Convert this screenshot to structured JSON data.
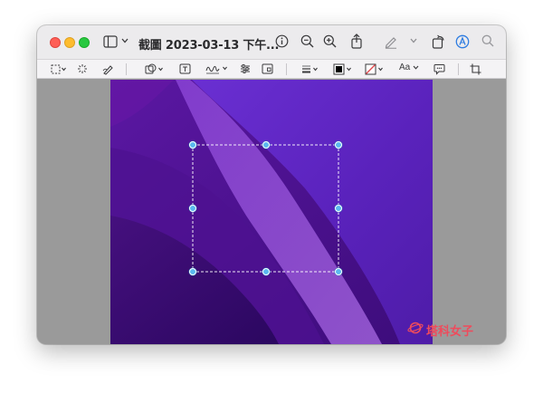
{
  "window": {
    "title": "截圖 2023-03-13 下午...",
    "controls": [
      "close",
      "minimize",
      "zoom"
    ]
  },
  "titlebar_icons": [
    "sidebar-icon",
    "chevron-down-icon",
    "info-icon",
    "zoom-out-icon",
    "zoom-in-icon",
    "share-icon",
    "highlight-pen-icon",
    "chevron-down-icon",
    "rotate-icon",
    "markup-icon",
    "search-icon"
  ],
  "markup_toolbar": {
    "tools": [
      "rectangular-selection-icon",
      "instant-alpha-icon",
      "sketch-icon",
      "shapes-icon",
      "text-box-icon",
      "signature-icon",
      "adjust-color-icon",
      "page-layout-icon",
      "border-style-icon",
      "border-color-icon",
      "fill-color-icon",
      "text-style-icon",
      "comment-icon",
      "crop-icon"
    ],
    "text_style_label": "Aa"
  },
  "colors": {
    "selection_handle": "#5ab8ef",
    "wallpaper_primary": "#5a1aa8",
    "watermark": "#ef4b5c"
  },
  "watermark": {
    "text": "塔科女子"
  }
}
